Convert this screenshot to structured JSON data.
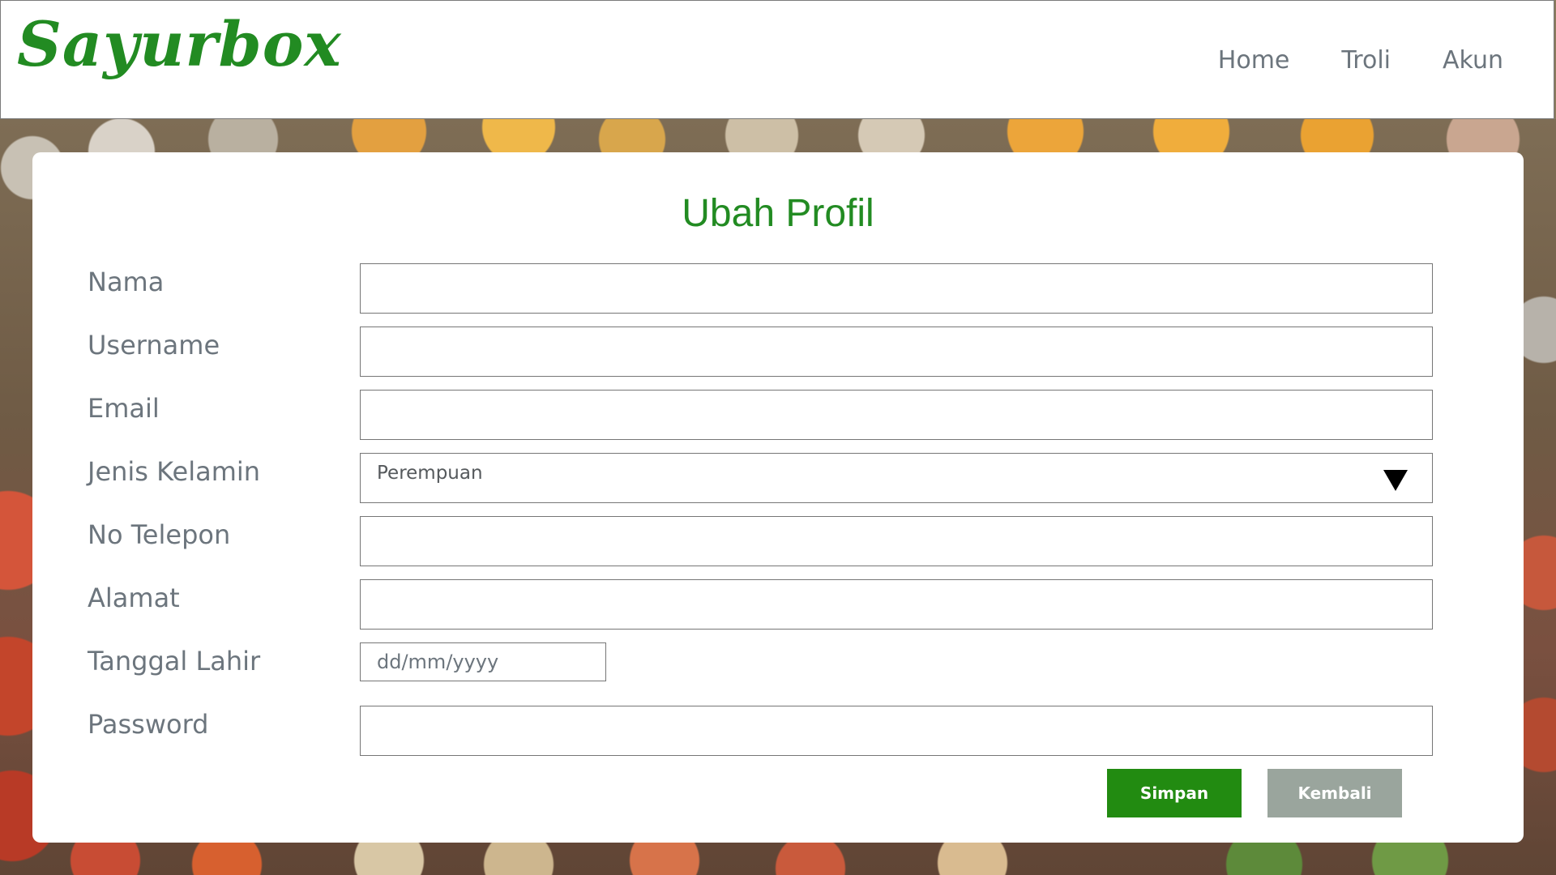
{
  "brand": {
    "logo": "Sayurbox",
    "color": "#228b22"
  },
  "nav": {
    "items": [
      {
        "label": "Home"
      },
      {
        "label": "Troli"
      },
      {
        "label": "Akun"
      }
    ]
  },
  "form": {
    "title": "Ubah Profil",
    "fields": {
      "nama": {
        "label": "Nama",
        "value": ""
      },
      "username": {
        "label": "Username",
        "value": ""
      },
      "email": {
        "label": "Email",
        "value": ""
      },
      "jenis_kelamin": {
        "label": "Jenis Kelamin",
        "selected": "Perempuan"
      },
      "no_telepon": {
        "label": "No Telepon",
        "value": ""
      },
      "alamat": {
        "label": "Alamat",
        "value": ""
      },
      "tanggal_lahir": {
        "label": "Tanggal Lahir",
        "placeholder": "dd/mm/yyyy"
      },
      "password": {
        "label": "Password",
        "value": ""
      }
    },
    "buttons": {
      "save": {
        "label": "Simpan",
        "color": "#228b11"
      },
      "back": {
        "label": "Kembali",
        "color": "#9aa59d"
      }
    }
  }
}
